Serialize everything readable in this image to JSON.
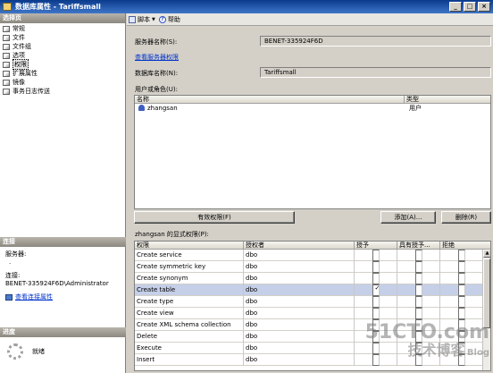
{
  "window": {
    "title": "数据库属性 - Tariffsmall",
    "btn_min": "_",
    "btn_max": "□",
    "btn_close": "×"
  },
  "left": {
    "select_page_header": "选择页",
    "nav_items": [
      {
        "label": "常规"
      },
      {
        "label": "文件"
      },
      {
        "label": "文件组"
      },
      {
        "label": "选项"
      },
      {
        "label": "权限"
      },
      {
        "label": "扩展属性"
      },
      {
        "label": "镜像"
      },
      {
        "label": "事务日志传送"
      }
    ],
    "connection_header": "连接",
    "server_label": "服务器:",
    "server_value": ".",
    "connection_label": "连接:",
    "connection_value": "BENET-335924F6D\\Administrator",
    "view_conn_props": "查看连接属性",
    "progress_header": "进度",
    "progress_status": "就绪"
  },
  "toolbar": {
    "script_label": "脚本",
    "help_label": "帮助"
  },
  "form": {
    "server_name_label": "服务器名称(S):",
    "server_name_value": "BENET-335924F6D",
    "view_server_perms": "查看服务器权限",
    "db_name_label": "数据库名称(N):",
    "db_name_value": "Tariffsmall",
    "users_roles_label": "用户或角色(U):"
  },
  "users_grid": {
    "headers": [
      "名称",
      "类型"
    ],
    "rows": [
      {
        "name": "zhangsan",
        "type": "用户"
      }
    ]
  },
  "buttons": {
    "effective": "有效权限(F)",
    "add": "添加(A)...",
    "remove": "删除(R)"
  },
  "perms": {
    "title": "zhangsan 的显式权限(P):",
    "headers": [
      "权限",
      "授权者",
      "授予",
      "具有授予...",
      "拒绝"
    ],
    "rows": [
      {
        "perm": "Create service",
        "grantor": "dbo",
        "grant": false,
        "with_grant": false,
        "deny": false
      },
      {
        "perm": "Create symmetric key",
        "grantor": "dbo",
        "grant": false,
        "with_grant": false,
        "deny": false
      },
      {
        "perm": "Create synonym",
        "grantor": "dbo",
        "grant": false,
        "with_grant": false,
        "deny": false
      },
      {
        "perm": "Create table",
        "grantor": "dbo",
        "grant": true,
        "with_grant": false,
        "deny": false
      },
      {
        "perm": "Create type",
        "grantor": "dbo",
        "grant": false,
        "with_grant": false,
        "deny": false
      },
      {
        "perm": "Create view",
        "grantor": "dbo",
        "grant": false,
        "with_grant": false,
        "deny": false
      },
      {
        "perm": "Create XML schema collection",
        "grantor": "dbo",
        "grant": false,
        "with_grant": false,
        "deny": false
      },
      {
        "perm": "Delete",
        "grantor": "dbo",
        "grant": false,
        "with_grant": false,
        "deny": false
      },
      {
        "perm": "Execute",
        "grantor": "dbo",
        "grant": false,
        "with_grant": false,
        "deny": false
      },
      {
        "perm": "Insert",
        "grantor": "dbo",
        "grant": false,
        "with_grant": false,
        "deny": false
      }
    ]
  },
  "watermark": {
    "line1": "51CTO.com",
    "line2": "技术博客",
    "line3": "Blog"
  }
}
